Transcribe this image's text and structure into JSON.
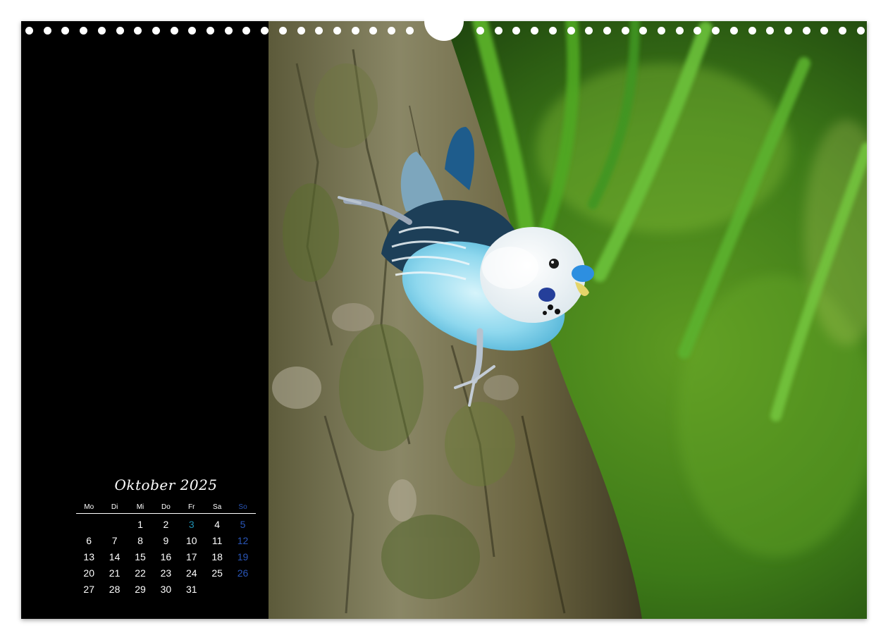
{
  "calendar": {
    "title": "Oktober 2025",
    "weekdays": [
      "Mo",
      "Di",
      "Mi",
      "Do",
      "Fr",
      "Sa",
      "So"
    ],
    "weeks": [
      [
        "",
        "",
        "1",
        "2",
        "3",
        "4",
        "5"
      ],
      [
        "6",
        "7",
        "8",
        "9",
        "10",
        "11",
        "12"
      ],
      [
        "13",
        "14",
        "15",
        "16",
        "17",
        "18",
        "19"
      ],
      [
        "20",
        "21",
        "22",
        "23",
        "24",
        "25",
        "26"
      ],
      [
        "27",
        "28",
        "29",
        "30",
        "31",
        "",
        ""
      ]
    ],
    "highlight": {
      "sunday_color": "#2a56b8",
      "holiday_color": "#1f8fb0",
      "holiday_date": "3"
    }
  },
  "photo": {
    "subject": "blue budgerigar on tree bark"
  },
  "colors": {
    "panel": "#000000",
    "page_background": "#ffffff",
    "text": "#ffffff"
  }
}
